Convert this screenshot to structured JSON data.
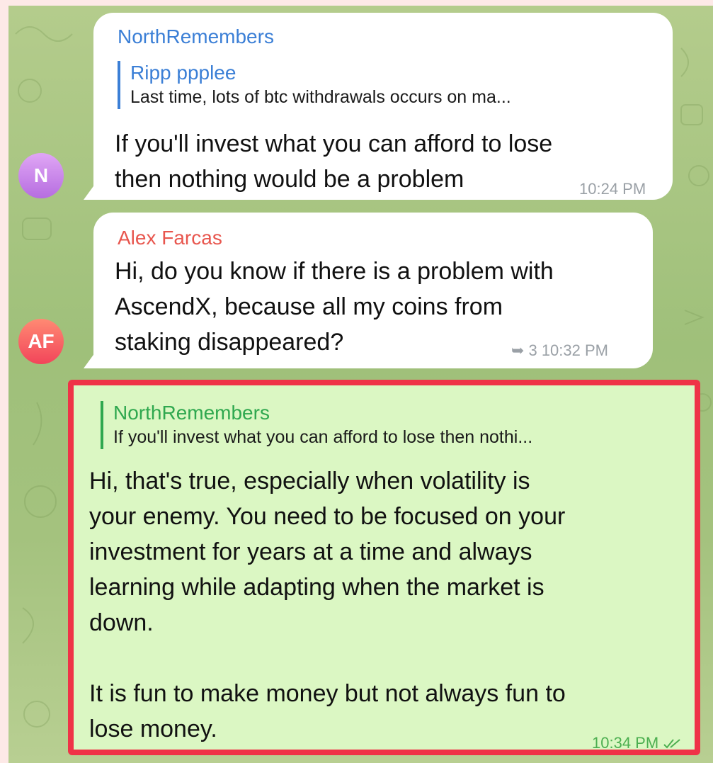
{
  "messages": [
    {
      "avatar_initials": "N",
      "sender": "NorthRemembers",
      "sender_color": "#3b7fd6",
      "reply_to": {
        "name": "Ripp ppplee",
        "text": "Last time, lots of btc withdrawals occurs on ma..."
      },
      "text_lines": [
        "If you'll invest what you can afford to lose",
        "then nothing would be a problem"
      ],
      "time": "10:24 PM"
    },
    {
      "avatar_initials": "AF",
      "sender": "Alex Farcas",
      "sender_color": "#e8564e",
      "text_lines": [
        "Hi, do you know if there is a problem with",
        "AscendX, because all my coins from",
        "staking disappeared?"
      ],
      "reply_count": "3",
      "time": "10:32 PM"
    },
    {
      "outgoing": true,
      "reply_to": {
        "name": "NorthRemembers",
        "text": "If you'll invest what you can afford to lose then nothi..."
      },
      "text_lines": [
        "Hi, that's true, especially when volatility is",
        "your enemy. You need to be focused on your",
        "investment for years at a time and always",
        "learning while adapting when the market is",
        "down.",
        "",
        "It is fun to make money but not always fun to",
        "lose money."
      ],
      "time": "10:34 PM",
      "status_icon": "double-check-icon",
      "highlight_color": "#ef3347"
    }
  ]
}
